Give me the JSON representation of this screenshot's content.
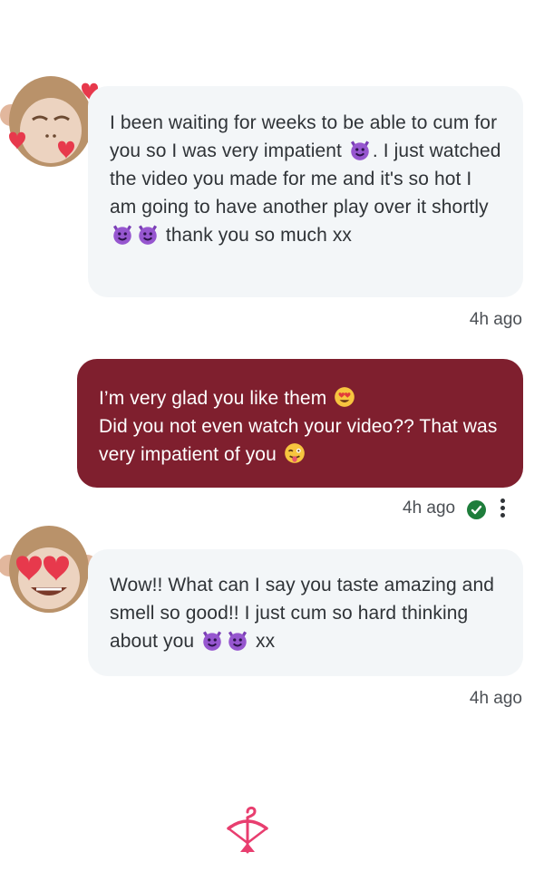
{
  "messages": [
    {
      "direction": "incoming",
      "avatar_icon": "monkey-with-hearts-icon",
      "text_part1": "I been waiting for weeks to be able to cum for you so I was very impatient ",
      "text_part2": ". I just watched the video you made for me and it's so hot I am going to have another play over it shortly ",
      "text_part3": " thank you so much xx",
      "time": "4h ago"
    },
    {
      "direction": "outgoing",
      "line1": "I’m very glad you like them ",
      "line2": "Did you not even watch your video?? That was very impatient of you ",
      "time": "4h ago",
      "status_icon": "delivered-check-icon",
      "menu_icon": "more-vertical-icon"
    },
    {
      "direction": "incoming",
      "avatar_icon": "heart-eyes-monkey-icon",
      "text_part1": "Wow!! What can I say you taste amazing and smell so good!! I just cum so hard thinking about you ",
      "text_part2": " xx",
      "time": "4h ago"
    }
  ],
  "footer": {
    "logo_icon": "bow-and-arrow-logo-icon"
  },
  "colors": {
    "outgoing_bubble": "#7f1f2e",
    "incoming_bubble": "#f3f6f8",
    "brand": "#e83e6f"
  }
}
